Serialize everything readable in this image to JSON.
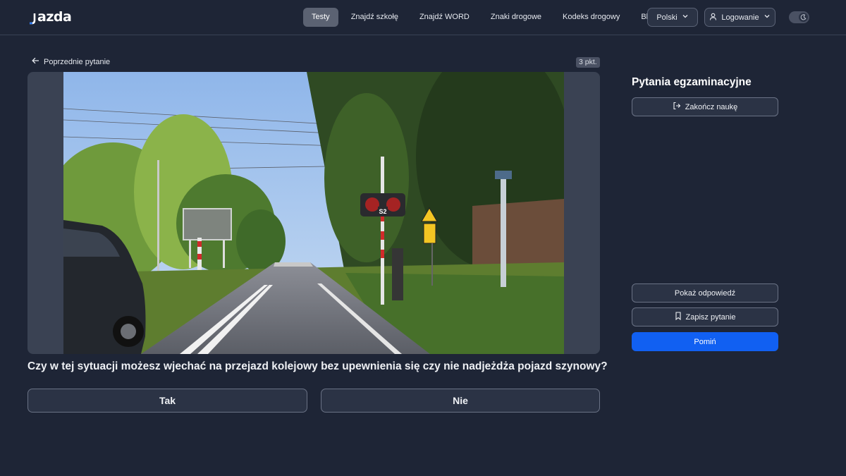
{
  "brand": {
    "logo_text": "azda"
  },
  "nav": {
    "items": [
      {
        "label": "Testy",
        "active": true
      },
      {
        "label": "Znajdź szkołę",
        "active": false
      },
      {
        "label": "Znajdź WORD",
        "active": false
      },
      {
        "label": "Znaki drogowe",
        "active": false
      },
      {
        "label": "Kodeks drogowy",
        "active": false
      },
      {
        "label": "Blog",
        "active": false
      }
    ],
    "language": "Polski",
    "login": "Logowanie"
  },
  "question_panel": {
    "back_label": "Poprzednie pytanie",
    "points": "3 pkt.",
    "media_sign_text": "S2",
    "question_text": "Czy w tej sytuacji możesz wjechać na przejazd kolejowy bez upewnienia się czy nie nadjeżdża pojazd szynowy?",
    "answers": {
      "yes": "Tak",
      "no": "Nie"
    }
  },
  "sidebar": {
    "title": "Pytania egzaminacyjne",
    "end_label": "Zakończ naukę",
    "show_answer_label": "Pokaż odpowiedź",
    "save_label": "Zapisz pytanie",
    "skip_label": "Pomiń"
  },
  "colors": {
    "background": "#1e2536",
    "accent": "#1160f2",
    "button_surface": "#2b3345"
  },
  "icons": {
    "back": "arrow-left-icon",
    "end": "logout-icon",
    "save": "bookmark-icon",
    "login": "user-icon",
    "dropdown": "chevron-down-icon",
    "theme": "moon-icon"
  }
}
